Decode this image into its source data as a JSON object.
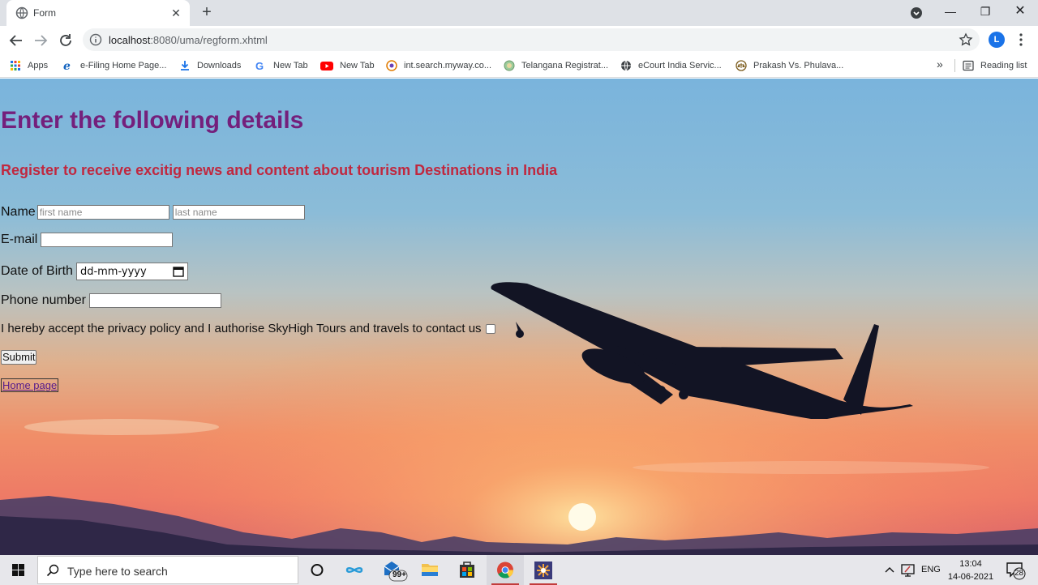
{
  "browser": {
    "tab_title": "Form",
    "tab_close": "✕",
    "new_tab": "+",
    "url_host": "localhost",
    "url_rest": ":8080/uma/regform.xhtml",
    "avatar_letter": "L",
    "win_minimize": "—",
    "win_maximize": "❐",
    "win_close": "✕"
  },
  "bookmarks": {
    "items": [
      {
        "label": "Apps",
        "icon": "apps-grid-icon"
      },
      {
        "label": "e-Filing Home Page...",
        "icon": "ie-icon"
      },
      {
        "label": "Downloads",
        "icon": "download-icon"
      },
      {
        "label": "New Tab",
        "icon": "google-icon"
      },
      {
        "label": "New Tab",
        "icon": "youtube-icon"
      },
      {
        "label": "int.search.myway.co...",
        "icon": "myway-icon"
      },
      {
        "label": "Telangana Registrat...",
        "icon": "seal-icon"
      },
      {
        "label": "eCourt India Servic...",
        "icon": "globe-icon"
      },
      {
        "label": "Prakash Vs. Phulava...",
        "icon": "scales-icon"
      }
    ],
    "more": "»",
    "reading_list": "Reading list"
  },
  "form": {
    "heading": "Enter the following details",
    "subheading": "Register to receive excitig news and content about tourism Destinations in India",
    "name_label": "Name",
    "first_name_placeholder": "first name",
    "last_name_placeholder": "last name",
    "email_label": "E-mail",
    "dob_label": "Date of Birth",
    "dob_placeholder": "dd-mm-yyyy",
    "phone_label": "Phone number",
    "consent_label": "I hereby accept the privacy policy and I authorise SkyHigh Tours and travels to contact us",
    "submit_label": "Submit",
    "home_link": "Home page"
  },
  "taskbar": {
    "search_placeholder": "Type here to search",
    "mail_badge": "99+",
    "language": "ENG",
    "time": "13:04",
    "date": "14-06-2021",
    "notification_count": "28"
  },
  "colors": {
    "heading": "#74207c",
    "subheading": "#c0283f",
    "link": "#551a8b",
    "accent": "#1a73e8"
  }
}
